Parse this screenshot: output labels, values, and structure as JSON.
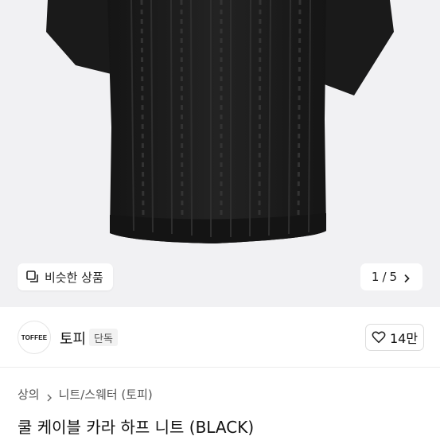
{
  "gallery": {
    "similar_label": "비슷한 상품",
    "page_current": "1",
    "page_separator": "/",
    "page_total": "5",
    "image_subject": "black cable-knit short-sleeve knit"
  },
  "store": {
    "logo_text": "TOFFEE",
    "name": "토피",
    "badge": "단독",
    "like_count": "14만"
  },
  "breadcrumb": {
    "items": [
      "상의",
      "니트/스웨터 (토피)"
    ]
  },
  "product": {
    "title": "쿨 케이블 카라 하프 니트 (BLACK)"
  },
  "colors": {
    "hero_bg": "#f1f1f3",
    "garment": "#1c1c1c"
  }
}
